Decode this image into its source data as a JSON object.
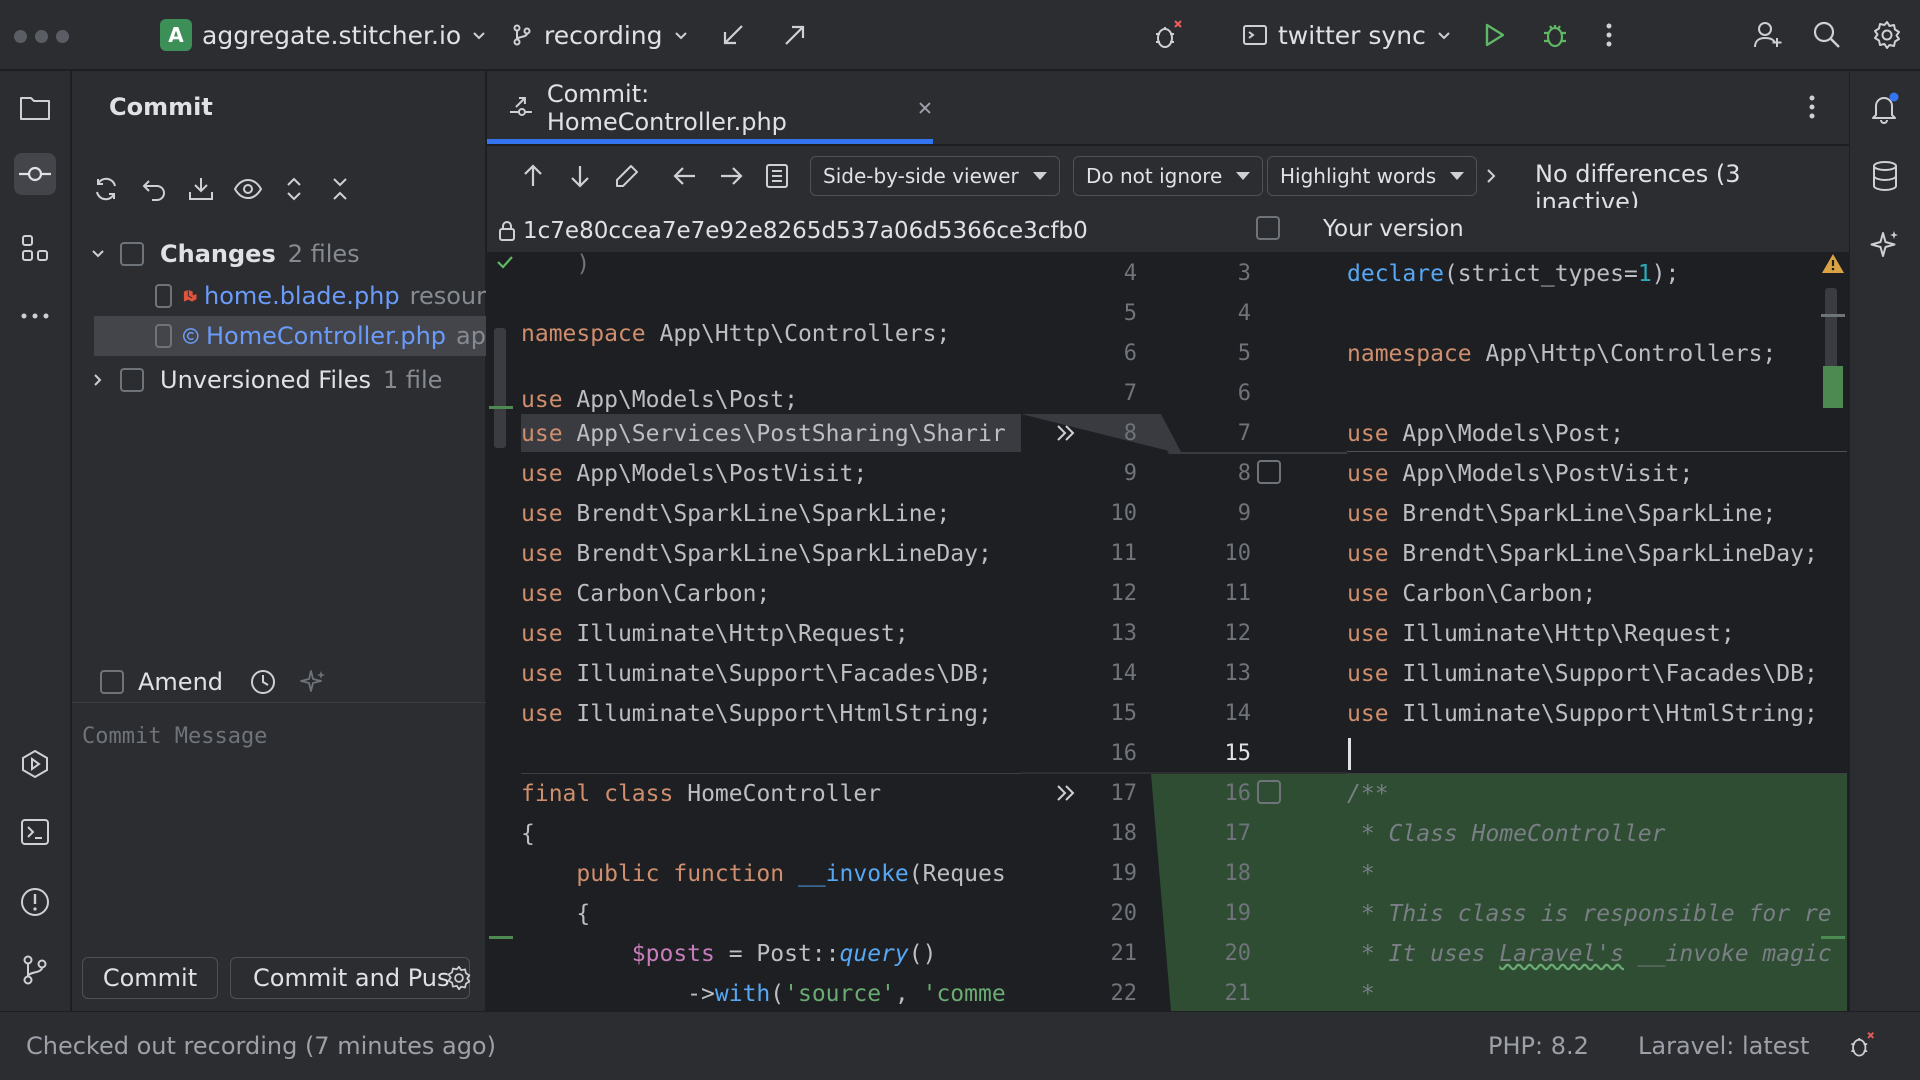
{
  "titlebar": {
    "project_initial": "A",
    "project_name": "aggregate.stitcher.io",
    "branch": "recording",
    "run_config": "twitter sync"
  },
  "commit_panel": {
    "title": "Commit",
    "changes_label": "Changes",
    "changes_count": "2 files",
    "files": [
      {
        "name": "home.blade.php",
        "path": "resour"
      },
      {
        "name": "HomeController.php",
        "path": "ap"
      }
    ],
    "unversioned_label": "Unversioned Files",
    "unversioned_count": "1 file",
    "amend_label": "Amend",
    "message_placeholder": "Commit Message",
    "commit_button": "Commit",
    "commit_push_button": "Commit and Pus"
  },
  "editor": {
    "tab_title": "Commit: HomeController.php",
    "viewer_mode": "Side-by-side viewer",
    "ignore_mode": "Do not ignore",
    "highlight_mode": "Highlight words",
    "diff_status": "No differences (3 inactive)",
    "left_hash": "1c7e80ccea7e7e92e8265d537a06d5366ce3cfb0",
    "right_title": "Your version"
  },
  "diff": {
    "left_numbers": [
      "4",
      "5",
      "6",
      "7",
      "8",
      "9",
      "10",
      "11",
      "12",
      "13",
      "14",
      "15",
      "16",
      "17",
      "18",
      "19",
      "20",
      "21",
      "22"
    ],
    "right_numbers": [
      "3",
      "4",
      "5",
      "6",
      "7",
      "8",
      "9",
      "10",
      "11",
      "12",
      "13",
      "14",
      "15",
      "16",
      "17",
      "18",
      "19",
      "20",
      "21"
    ],
    "left_lines": {
      "l5": "App\\Http\\Controllers;",
      "l7": "App\\Models\\Post;",
      "l8": "App\\Services\\PostSharing\\Sharir",
      "l9": "App\\Models\\PostVisit;",
      "l10": "Brendt\\SparkLine\\SparkLine;",
      "l11": "Brendt\\SparkLine\\SparkLineDay;",
      "l12": "Carbon\\Carbon;",
      "l13": "Illuminate\\Http\\Request;",
      "l14": "Illuminate\\Support\\Facades\\DB;",
      "l15": "Illuminate\\Support\\HtmlString;",
      "l17": "HomeController",
      "l18": "{",
      "l19_fn": "__invoke",
      "l19_rest": "(Reques",
      "l20": "{",
      "l21_var": "$posts",
      "l21_mid": " = Post::",
      "l21_call": "query",
      "l21_end": "()",
      "l22_pre": "->",
      "l22_fn": "with",
      "l22_a": "(",
      "l22_s1": "'source'",
      "l22_b": ", ",
      "l22_s2": "'comme"
    },
    "right_lines": {
      "r3_fn": "declare",
      "r3_a": "(strict_types=",
      "r3_num": "1",
      "r3_b": ");",
      "r5": "App\\Http\\Controllers;",
      "r7": "App\\Models\\Post;",
      "r8": "App\\Models\\PostVisit;",
      "r9": "Brendt\\SparkLine\\SparkLine;",
      "r10": "Brendt\\SparkLine\\SparkLineDay;",
      "r11": "Carbon\\Carbon;",
      "r12": "Illuminate\\Http\\Request;",
      "r13": "Illuminate\\Support\\Facades\\DB;",
      "r14": "Illuminate\\Support\\HtmlString;",
      "r16": "/**",
      "r17": " * Class HomeController",
      "r18": " *",
      "r19": " * This class is responsible for re",
      "r20_a": " * It uses ",
      "r20_b": "Laravel's",
      "r20_c": " __invoke magic",
      "r21": " *"
    },
    "keywords": {
      "namespace": "namespace",
      "use": "use",
      "final": "final",
      "class": "class",
      "public": "public",
      "function": "function"
    }
  },
  "statusbar": {
    "message": "Checked out recording (7 minutes ago)",
    "php": "PHP: 8.2",
    "laravel": "Laravel: latest"
  },
  "colors": {
    "accent": "#3574f0",
    "added_bg": "#2e4d33",
    "modified_bg": "#393b40",
    "keyword": "#cf8e6d",
    "function": "#56a8f5",
    "string": "#6aab73",
    "link": "#6b9bfa"
  }
}
